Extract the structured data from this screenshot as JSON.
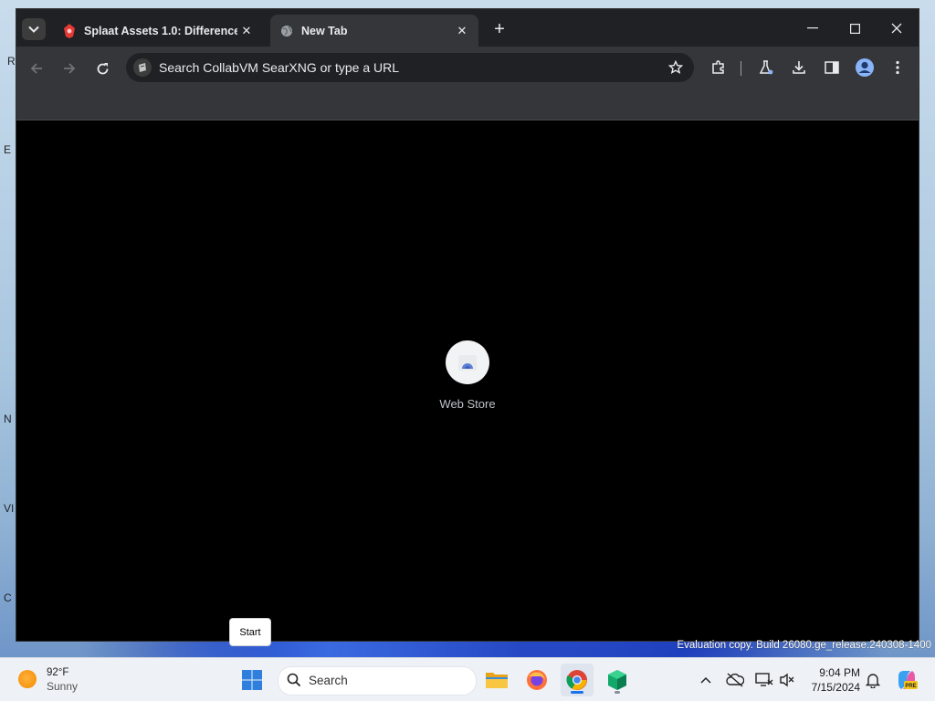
{
  "browser": {
    "tabs": [
      {
        "title": "Splaat Assets 1.0: Difference be",
        "active": false
      },
      {
        "title": "New Tab",
        "active": true
      }
    ],
    "omnibox": {
      "placeholder": "Search CollabVM SearXNG or type a URL"
    },
    "shortcuts": [
      {
        "label": "Web Store"
      }
    ]
  },
  "desktop": {
    "watermark": "Evaluation copy. Build 26080.ge_release.240308-1400",
    "edge_letters": [
      "R",
      "E",
      "N",
      "VI",
      "C"
    ]
  },
  "tooltip": {
    "text": "Start"
  },
  "taskbar": {
    "weather": {
      "temp": "92°F",
      "condition": "Sunny"
    },
    "search_label": "Search",
    "clock": {
      "time": "9:04 PM",
      "date": "7/15/2024"
    }
  },
  "colors": {
    "tab_strip": "#202124",
    "toolbar": "#35363a",
    "accent": "#1a73e8"
  }
}
